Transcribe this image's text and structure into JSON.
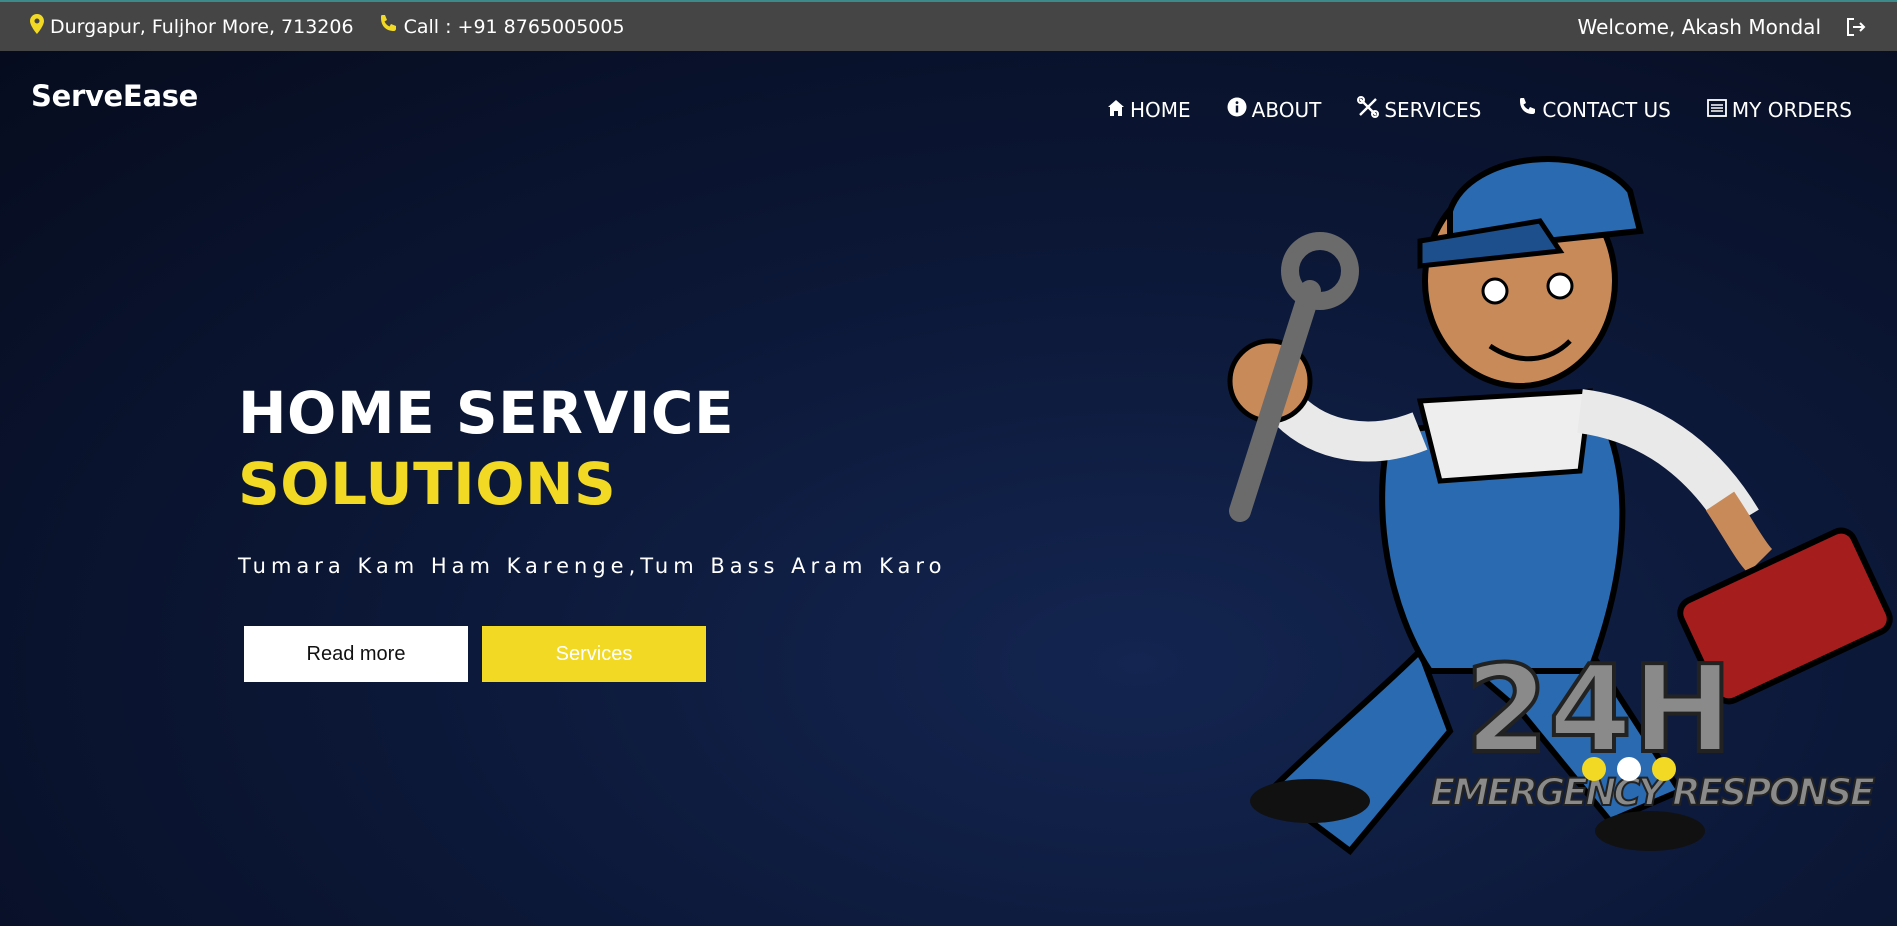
{
  "topbar": {
    "address": "Durgapur, Fuljhor More, 713206",
    "phone": "Call : +91 8765005005",
    "welcome": "Welcome, Akash Mondal",
    "icons": [
      "location-pin-icon",
      "phone-icon",
      "logout-icon"
    ]
  },
  "brand": "ServeEase",
  "nav": {
    "home": "HOME",
    "about": "ABOUT",
    "services": "SERVICES",
    "contact": "CONTACT US",
    "orders": "MY ORDERS"
  },
  "hero": {
    "title_line1": "HOME SERVICE",
    "title_line2": "SOLUTIONS",
    "tagline": "Tumara Kam Ham Karenge,Tum Bass Aram Karo",
    "read_more": "Read more",
    "services_button": "Services",
    "badge_big": "24H",
    "badge_text": "EMERGENCY RESPONSE"
  },
  "carousel": {
    "slide_count": 3,
    "active_index": 1
  },
  "colors": {
    "accent_yellow": "#f1d924",
    "topbar_bg": "#454545",
    "hero_bg": "#0b1530"
  }
}
